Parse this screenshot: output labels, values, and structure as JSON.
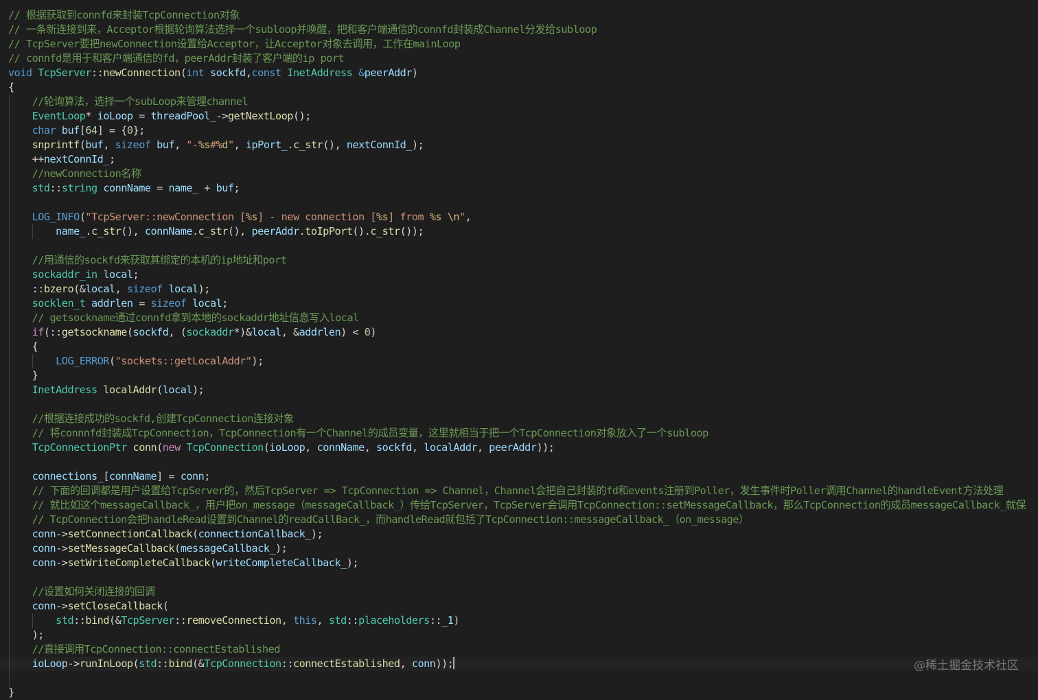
{
  "editor": {
    "colors": {
      "background": "#1e1e1e",
      "comment": "#6a9955",
      "keyword": "#569cd6",
      "type": "#4ec9b0",
      "function": "#dcdcaa",
      "variable": "#9cdcfe",
      "string": "#ce9178"
    },
    "lines": [
      [
        [
          "c",
          "// 根据获取到connfd来封装TcpConnection对象"
        ]
      ],
      [
        [
          "c",
          "// 一条新连接到来，Acceptor根据轮询算法选择一个subloop并唤醒，把和客户端通信的connfd封装成Channel分发给subloop"
        ]
      ],
      [
        [
          "c",
          "// TcpServer要把newConnection设置给Acceptor，让Acceptor对象去调用，工作在mainLoop"
        ]
      ],
      [
        [
          "c",
          "// connfd是用于和客户端通信的fd，peerAddr封装了客户端的ip port"
        ]
      ],
      [
        [
          "k",
          "void"
        ],
        [
          "p",
          " "
        ],
        [
          "t",
          "TcpServer"
        ],
        [
          "p",
          "::"
        ],
        [
          "f",
          "newConnection"
        ],
        [
          "p",
          "("
        ],
        [
          "k",
          "int"
        ],
        [
          "p",
          " "
        ],
        [
          "v",
          "sockfd"
        ],
        [
          "p",
          ","
        ],
        [
          "k",
          "const"
        ],
        [
          "p",
          " "
        ],
        [
          "t",
          "InetAddress"
        ],
        [
          "p",
          " "
        ],
        [
          "k",
          "&"
        ],
        [
          "v",
          "peerAddr"
        ],
        [
          "p",
          ")"
        ]
      ],
      [
        [
          "p",
          "{"
        ]
      ],
      [
        [
          "p",
          "    "
        ],
        [
          "c",
          "//轮询算法，选择一个subLoop来管理channel"
        ]
      ],
      [
        [
          "p",
          "    "
        ],
        [
          "t",
          "EventLoop"
        ],
        [
          "p",
          "* "
        ],
        [
          "v",
          "ioLoop"
        ],
        [
          "p",
          " = "
        ],
        [
          "v",
          "threadPool_"
        ],
        [
          "p",
          "->"
        ],
        [
          "f",
          "getNextLoop"
        ],
        [
          "p",
          "();"
        ]
      ],
      [
        [
          "p",
          "    "
        ],
        [
          "k",
          "char"
        ],
        [
          "p",
          " "
        ],
        [
          "v",
          "buf"
        ],
        [
          "p",
          "["
        ],
        [
          "n",
          "64"
        ],
        [
          "p",
          "] = {"
        ],
        [
          "n",
          "0"
        ],
        [
          "p",
          "};"
        ]
      ],
      [
        [
          "p",
          "    "
        ],
        [
          "f",
          "snprintf"
        ],
        [
          "p",
          "("
        ],
        [
          "v",
          "buf"
        ],
        [
          "p",
          ", "
        ],
        [
          "k",
          "sizeof"
        ],
        [
          "p",
          " "
        ],
        [
          "v",
          "buf"
        ],
        [
          "p",
          ", "
        ],
        [
          "s",
          "\"-"
        ],
        [
          "e",
          "%s"
        ],
        [
          "s",
          "#"
        ],
        [
          "e",
          "%d"
        ],
        [
          "s",
          "\""
        ],
        [
          "p",
          ", "
        ],
        [
          "v",
          "ipPort_"
        ],
        [
          "p",
          "."
        ],
        [
          "f",
          "c_str"
        ],
        [
          "p",
          "(), "
        ],
        [
          "v",
          "nextConnId_"
        ],
        [
          "p",
          ");"
        ]
      ],
      [
        [
          "p",
          "    ++"
        ],
        [
          "v",
          "nextConnId_"
        ],
        [
          "p",
          ";"
        ]
      ],
      [
        [
          "p",
          "    "
        ],
        [
          "c",
          "//newConnection名称"
        ]
      ],
      [
        [
          "p",
          "    "
        ],
        [
          "t",
          "std"
        ],
        [
          "p",
          "::"
        ],
        [
          "t",
          "string"
        ],
        [
          "p",
          " "
        ],
        [
          "v",
          "connName"
        ],
        [
          "p",
          " = "
        ],
        [
          "v",
          "name_"
        ],
        [
          "p",
          " + "
        ],
        [
          "v",
          "buf"
        ],
        [
          "p",
          ";"
        ]
      ],
      [],
      [
        [
          "p",
          "    "
        ],
        [
          "m",
          "LOG_INFO"
        ],
        [
          "p",
          "("
        ],
        [
          "s",
          "\"TcpServer::newConnection ["
        ],
        [
          "e",
          "%s"
        ],
        [
          "s",
          "] - new connection ["
        ],
        [
          "e",
          "%s"
        ],
        [
          "s",
          "] from "
        ],
        [
          "e",
          "%s"
        ],
        [
          "s",
          " "
        ],
        [
          "e",
          "\\n"
        ],
        [
          "s",
          "\""
        ],
        [
          "p",
          ","
        ]
      ],
      [
        [
          "p",
          "        "
        ],
        [
          "v",
          "name_"
        ],
        [
          "p",
          "."
        ],
        [
          "f",
          "c_str"
        ],
        [
          "p",
          "(), "
        ],
        [
          "v",
          "connName"
        ],
        [
          "p",
          "."
        ],
        [
          "f",
          "c_str"
        ],
        [
          "p",
          "(), "
        ],
        [
          "v",
          "peerAddr"
        ],
        [
          "p",
          "."
        ],
        [
          "f",
          "toIpPort"
        ],
        [
          "p",
          "()."
        ],
        [
          "f",
          "c_str"
        ],
        [
          "p",
          "());"
        ]
      ],
      [],
      [
        [
          "p",
          "    "
        ],
        [
          "c",
          "//用通信的sockfd来获取其绑定的本机的ip地址和port"
        ]
      ],
      [
        [
          "p",
          "    "
        ],
        [
          "t",
          "sockaddr_in"
        ],
        [
          "p",
          " "
        ],
        [
          "v",
          "local"
        ],
        [
          "p",
          ";"
        ]
      ],
      [
        [
          "p",
          "    ::"
        ],
        [
          "f",
          "bzero"
        ],
        [
          "p",
          "(&"
        ],
        [
          "v",
          "local"
        ],
        [
          "p",
          ", "
        ],
        [
          "k",
          "sizeof"
        ],
        [
          "p",
          " "
        ],
        [
          "v",
          "local"
        ],
        [
          "p",
          ");"
        ]
      ],
      [
        [
          "p",
          "    "
        ],
        [
          "t",
          "socklen_t"
        ],
        [
          "p",
          " "
        ],
        [
          "v",
          "addrlen"
        ],
        [
          "p",
          " = "
        ],
        [
          "k",
          "sizeof"
        ],
        [
          "p",
          " "
        ],
        [
          "v",
          "local"
        ],
        [
          "p",
          ";"
        ]
      ],
      [
        [
          "p",
          "    "
        ],
        [
          "c",
          "// getsockname通过connfd拿到本地的sockaddr地址信息写入local"
        ]
      ],
      [
        [
          "p",
          "    "
        ],
        [
          "x",
          "if"
        ],
        [
          "p",
          "(::"
        ],
        [
          "f",
          "getsockname"
        ],
        [
          "p",
          "("
        ],
        [
          "v",
          "sockfd"
        ],
        [
          "p",
          ", ("
        ],
        [
          "t",
          "sockaddr"
        ],
        [
          "p",
          "*)&"
        ],
        [
          "v",
          "local"
        ],
        [
          "p",
          ", &"
        ],
        [
          "v",
          "addrlen"
        ],
        [
          "p",
          ") < "
        ],
        [
          "n",
          "0"
        ],
        [
          "p",
          ")"
        ]
      ],
      [
        [
          "p",
          "    {"
        ]
      ],
      [
        [
          "p",
          "        "
        ],
        [
          "m",
          "LOG_ERROR"
        ],
        [
          "p",
          "("
        ],
        [
          "s",
          "\"sockets::getLocalAddr\""
        ],
        [
          "p",
          ");"
        ]
      ],
      [
        [
          "p",
          "    }"
        ]
      ],
      [
        [
          "p",
          "    "
        ],
        [
          "t",
          "InetAddress"
        ],
        [
          "p",
          " "
        ],
        [
          "f",
          "localAddr"
        ],
        [
          "p",
          "("
        ],
        [
          "v",
          "local"
        ],
        [
          "p",
          ");"
        ]
      ],
      [],
      [
        [
          "p",
          "    "
        ],
        [
          "c",
          "//根据连接成功的sockfd,创建TcpConnection连接对象"
        ]
      ],
      [
        [
          "p",
          "    "
        ],
        [
          "c",
          "// 将connnfd封装成TcpConnection，TcpConnection有一个Channel的成员变量，这里就相当于把一个TcpConnection对象放入了一个subloop"
        ]
      ],
      [
        [
          "p",
          "    "
        ],
        [
          "t",
          "TcpConnectionPtr"
        ],
        [
          "p",
          " "
        ],
        [
          "f",
          "conn"
        ],
        [
          "p",
          "("
        ],
        [
          "x",
          "new"
        ],
        [
          "p",
          " "
        ],
        [
          "t",
          "TcpConnection"
        ],
        [
          "p",
          "("
        ],
        [
          "v",
          "ioLoop"
        ],
        [
          "p",
          ", "
        ],
        [
          "v",
          "connName"
        ],
        [
          "p",
          ", "
        ],
        [
          "v",
          "sockfd"
        ],
        [
          "p",
          ", "
        ],
        [
          "v",
          "localAddr"
        ],
        [
          "p",
          ", "
        ],
        [
          "v",
          "peerAddr"
        ],
        [
          "p",
          "));"
        ]
      ],
      [],
      [
        [
          "p",
          "    "
        ],
        [
          "v",
          "connections_"
        ],
        [
          "p",
          "["
        ],
        [
          "v",
          "connName"
        ],
        [
          "p",
          "] = "
        ],
        [
          "v",
          "conn"
        ],
        [
          "p",
          ";"
        ]
      ],
      [
        [
          "p",
          "    "
        ],
        [
          "c",
          "// 下面的回调都是用户设置给TcpServer的，然后TcpServer => TcpConnection => Channel，Channel会把自己封装的fd和events注册到Poller，发生事件时Poller调用Channel的handleEvent方法处理"
        ]
      ],
      [
        [
          "p",
          "    "
        ],
        [
          "c",
          "// 就比如这个messageCallback_，用户把on_message（messageCallback_）传给TcpServer，TcpServer会调用TcpConnection::setMessageCallback，那么TcpConnection的成员messageCallback_就保"
        ]
      ],
      [
        [
          "p",
          "    "
        ],
        [
          "c",
          "// TcpConnection会把handleRead设置到Channel的readCallBack_，而handleRead就包括了TcpConnection::messageCallback_（on_message）"
        ]
      ],
      [
        [
          "p",
          "    "
        ],
        [
          "v",
          "conn"
        ],
        [
          "p",
          "->"
        ],
        [
          "f",
          "setConnectionCallback"
        ],
        [
          "p",
          "("
        ],
        [
          "v",
          "connectionCallback_"
        ],
        [
          "p",
          ");"
        ]
      ],
      [
        [
          "p",
          "    "
        ],
        [
          "v",
          "conn"
        ],
        [
          "p",
          "->"
        ],
        [
          "f",
          "setMessageCallback"
        ],
        [
          "p",
          "("
        ],
        [
          "v",
          "messageCallback_"
        ],
        [
          "p",
          ");"
        ]
      ],
      [
        [
          "p",
          "    "
        ],
        [
          "v",
          "conn"
        ],
        [
          "p",
          "->"
        ],
        [
          "f",
          "setWriteCompleteCallback"
        ],
        [
          "p",
          "("
        ],
        [
          "v",
          "writeCompleteCallback_"
        ],
        [
          "p",
          ");"
        ]
      ],
      [],
      [
        [
          "p",
          "    "
        ],
        [
          "c",
          "//设置如何关闭连接的回调"
        ]
      ],
      [
        [
          "p",
          "    "
        ],
        [
          "v",
          "conn"
        ],
        [
          "p",
          "->"
        ],
        [
          "f",
          "setCloseCallback"
        ],
        [
          "p",
          "("
        ]
      ],
      [
        [
          "p",
          "        "
        ],
        [
          "t",
          "std"
        ],
        [
          "p",
          "::"
        ],
        [
          "f",
          "bind"
        ],
        [
          "p",
          "(&"
        ],
        [
          "t",
          "TcpServer"
        ],
        [
          "p",
          "::"
        ],
        [
          "f",
          "removeConnection"
        ],
        [
          "p",
          ", "
        ],
        [
          "k",
          "this"
        ],
        [
          "p",
          ", "
        ],
        [
          "t",
          "std"
        ],
        [
          "p",
          "::"
        ],
        [
          "t",
          "placeholders"
        ],
        [
          "p",
          "::"
        ],
        [
          "v",
          "_1"
        ],
        [
          "p",
          ")"
        ]
      ],
      [
        [
          "p",
          "    );"
        ]
      ],
      [
        [
          "p",
          "    "
        ],
        [
          "c",
          "//直接调用TcpConnection::connectEstablished"
        ]
      ],
      [
        [
          "p",
          "    "
        ],
        [
          "v",
          "ioLoop"
        ],
        [
          "p",
          "->"
        ],
        [
          "f",
          "runInLoop"
        ],
        [
          "p",
          "("
        ],
        [
          "t",
          "std"
        ],
        [
          "p",
          "::"
        ],
        [
          "f",
          "bind"
        ],
        [
          "p",
          "(&"
        ],
        [
          "t",
          "TcpConnection"
        ],
        [
          "p",
          "::"
        ],
        [
          "f",
          "connectEstablished"
        ],
        [
          "p",
          ", "
        ],
        [
          "v",
          "conn"
        ],
        [
          "p",
          "));"
        ]
      ],
      [],
      [
        [
          "p",
          "}"
        ]
      ]
    ]
  },
  "watermark": "@稀土掘金技术社区"
}
